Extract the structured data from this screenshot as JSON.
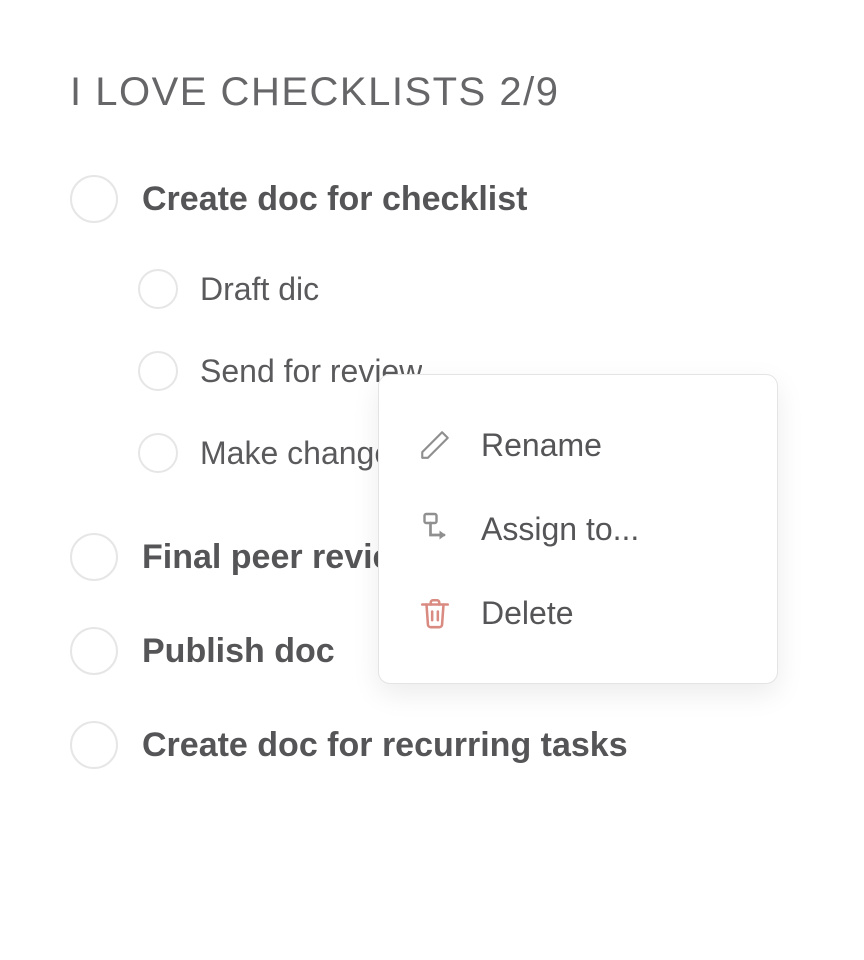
{
  "title": "I LOVE CHECKLISTS 2/9",
  "checklist": {
    "items": [
      {
        "label": "Create doc for checklist"
      },
      {
        "label": "Final peer review"
      },
      {
        "label": "Publish doc"
      },
      {
        "label": "Create doc for recurring tasks"
      }
    ],
    "subitems": [
      {
        "label": "Draft dic"
      },
      {
        "label": "Send for review"
      },
      {
        "label": "Make changes"
      }
    ]
  },
  "context_menu": {
    "rename": "Rename",
    "assign": "Assign to...",
    "delete": "Delete"
  },
  "colors": {
    "text_primary": "#555557",
    "border_light": "#e6e6e6",
    "accent_delete": "#d98b82"
  }
}
